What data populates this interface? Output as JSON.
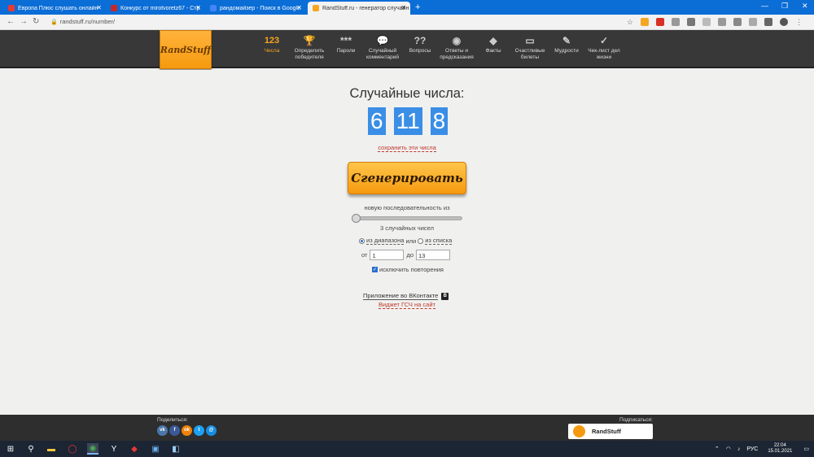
{
  "browser": {
    "tabs": [
      {
        "title": "Европа Плюс слушать онлайн",
        "active": false,
        "color": "#e53935"
      },
      {
        "title": "Конкурс от mirotvoretz67 - Стр",
        "active": false,
        "color": "#c62828"
      },
      {
        "title": "рандомайзер - Поиск в Google",
        "active": false,
        "color": "#4285f4"
      },
      {
        "title": "RandStuff.ru - генератор случайн",
        "active": true,
        "color": "#f6a522"
      }
    ],
    "new_tab": "+",
    "url": "randstuff.ru/number/"
  },
  "site": {
    "logo": "RandStuff",
    "nav": [
      {
        "icon": "123",
        "label": "Числа",
        "active": true
      },
      {
        "icon": "🏆",
        "label": "Определить победителя",
        "active": false
      },
      {
        "icon": "***",
        "label": "Пароли",
        "active": false
      },
      {
        "icon": "💬",
        "label": "Случайный комментарий",
        "active": false
      },
      {
        "icon": "??",
        "label": "Вопросы",
        "active": false
      },
      {
        "icon": "◉",
        "label": "Ответы и предсказания",
        "active": false
      },
      {
        "icon": "◆",
        "label": "Факты",
        "active": false
      },
      {
        "icon": "▭",
        "label": "Счастливые билеты",
        "active": false
      },
      {
        "icon": "✎",
        "label": "Мудрости",
        "active": false
      },
      {
        "icon": "✓",
        "label": "Чек-лист дел жизни",
        "active": false
      }
    ]
  },
  "main": {
    "title": "Случайные числа:",
    "numbers": [
      "6",
      "11",
      "8"
    ],
    "save_link": "сохранить эти числа",
    "generate_button": "Сгенерировать",
    "sequence_label": "новую последовательность из",
    "count_label": "3 случайных чисел",
    "slider_value": 3,
    "mode": {
      "range_label": "из диапазона",
      "or": "или",
      "list_label": "из списка",
      "selected": "range"
    },
    "range": {
      "from_label": "от",
      "from_value": "1",
      "to_label": "до",
      "to_value": "13"
    },
    "exclude_repeats": {
      "label": "исключить повторения",
      "checked": true
    },
    "vk_app_link": "Приложение во ВКонтакте",
    "vk_badge": "В",
    "widget_link": "Виджет ГСЧ на сайт"
  },
  "footer": {
    "share_label": "Поделиться:",
    "share_icons": [
      {
        "name": "vk",
        "glyph": "vk",
        "color": "#4a76a8"
      },
      {
        "name": "facebook",
        "glyph": "f",
        "color": "#3b5998"
      },
      {
        "name": "odnoklassniki",
        "glyph": "ok",
        "color": "#ee8208"
      },
      {
        "name": "twitter",
        "glyph": "t",
        "color": "#1da1f2"
      },
      {
        "name": "mail",
        "glyph": "@",
        "color": "#168de2"
      }
    ],
    "subscribe_label": "Подписаться:",
    "subscribe_name": "RandStuff"
  },
  "taskbar": {
    "language": "РУС",
    "time": "22:04",
    "date": "15.01.2021"
  }
}
